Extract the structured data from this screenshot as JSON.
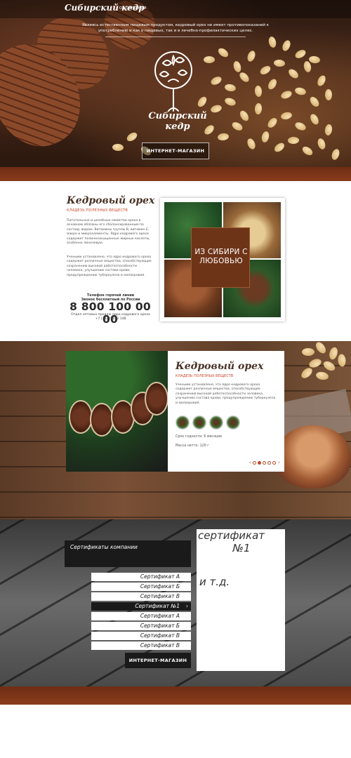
{
  "hero": {
    "brand_small": "Сибирский кедр",
    "nav_label": "О КОМПАНИИ",
    "description": "Являясь естественным пищевым продуктом, кедровый орех не имеет противопоказаний к употреблению и как в пищевых, так и в лечебно-профилактических целях.",
    "brand_large": "Сибирский кедр",
    "shop_button": "ИНТЕРНЕТ-МАГАЗИН"
  },
  "about": {
    "title": "Кедровый орех",
    "subtitle": "КЛАДЕЗЬ ПОЛЕЗНЫХ ВЕЩЕСТВ",
    "paragraph1": "Питательные и целебные свойства ореха в основном обязаны его сбалансированным по составу жирам. Витамины группы В, витамин Е, макро и микроэлементы. Ядро кедрового ореха содержит полиненасыщенные жирные кислоты, особенно линолевую.",
    "paragraph2": "Учеными установлено, что ядро кедрового ореха содержит различные вещества, способствующие сохранению высокой работоспособности человека, улучшению состава крови, предупреждению туберкулеза и малокровия.",
    "hotline_label": "Телефон горячей линии",
    "hotline_free": "Звонок бесплатный по России",
    "phone": "8 800 100 00 00",
    "wholesale_label": "Отдел оптовых продаж ядра кедрового ореха",
    "wholesale_phone": "+7 (3822) 012 148",
    "collage_caption": "ИЗ СИБИРИ С ЛЮБОВЬЮ"
  },
  "product": {
    "title": "Кедровый орех",
    "subtitle": "КЛАДЕЗЬ ПОЛЕЗНЫХ ВЕЩЕСТВ",
    "description": "Учеными установлено, что ядро кедрового ореха содержит различные вещества, способствующие сохранению высокой работоспособности человека, улучшению состава крови, предупреждению туберкулеза и малокровия.",
    "shelf_life": "Срок годности: 6 месяцев",
    "weight": "Масса нетто: 120 г",
    "prev_arrow": "‹",
    "next_arrow": "›",
    "pager_count": 5,
    "pager_active": 1
  },
  "certificates": {
    "header": "Сертификаты компании",
    "group1": [
      "Сертификат А",
      "Сертификат Б",
      "Сертификат В"
    ],
    "active_item": "Сертификат №1",
    "group2": [
      "Сертификат А",
      "Сертификат Б",
      "Сертификат В",
      "Сертификат В"
    ],
    "shop_button": "ИНТЕРНЕТ-МАГАЗИН",
    "panel_title": "сертификат",
    "panel_number": "№1",
    "panel_more": "и т.д."
  },
  "icons": {
    "chevron": "›"
  },
  "colors": {
    "accent_red": "#c8452a",
    "band_brown": "#7a3418",
    "dark": "#1a1a1a"
  }
}
